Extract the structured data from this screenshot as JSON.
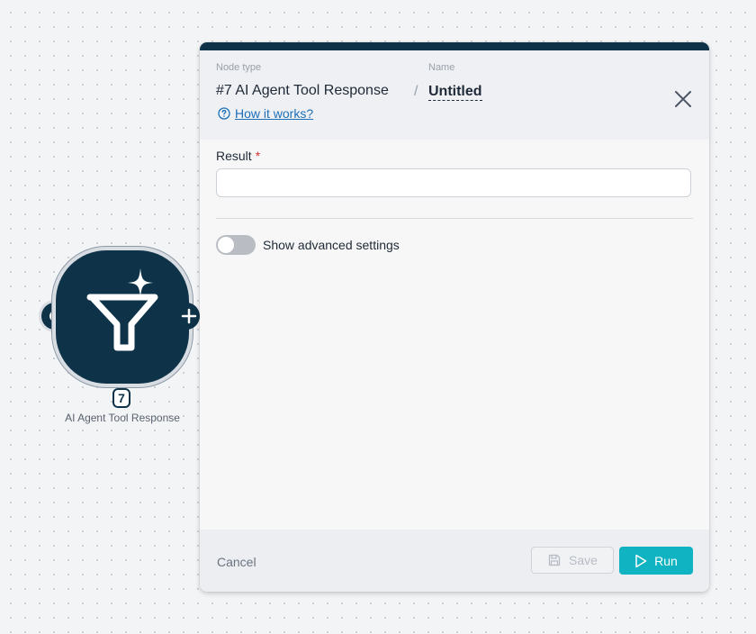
{
  "node": {
    "badge": "7",
    "label": "AI Agent Tool Response",
    "icon": "ai-filter-sparkle-icon"
  },
  "panel": {
    "header": {
      "node_type_label": "Node type",
      "node_type_value": "#7 AI Agent Tool Response",
      "separator": "/",
      "name_label": "Name",
      "name_value": "Untitled",
      "help_link": "How it works?"
    },
    "form": {
      "result_label": "Result",
      "required_marker": "*",
      "result_value": "",
      "advanced_toggle_label": "Show advanced settings",
      "advanced_toggle_on": false
    },
    "footer": {
      "cancel_label": "Cancel",
      "save_label": "Save",
      "run_label": "Run"
    }
  },
  "colors": {
    "brand_dark": "#0e3349",
    "accent": "#0fb3c2",
    "link": "#1d6fb8",
    "required": "#d32f2f"
  }
}
